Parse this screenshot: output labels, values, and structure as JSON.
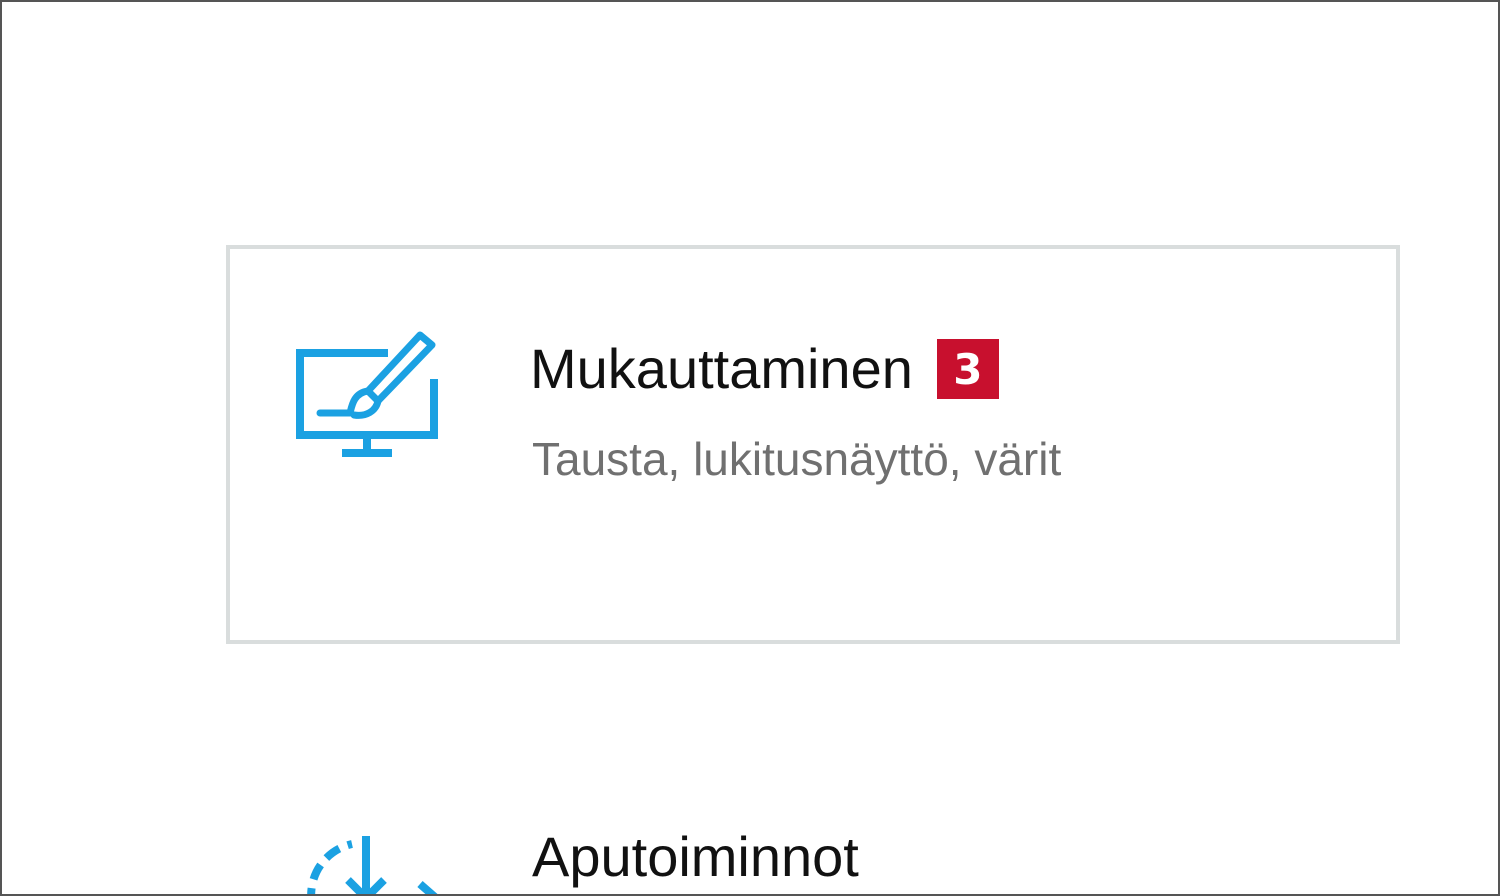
{
  "settings_items": [
    {
      "title": "Mukauttaminen",
      "subtitle": "Tausta, lukitusnäyttö, värit",
      "badge": "3",
      "icon": "personalization-icon"
    },
    {
      "title": "Aputoiminnot",
      "icon": "accessibility-icon"
    }
  ],
  "colors": {
    "accent": "#1ba1e2",
    "badge": "#c8102e",
    "tile_border": "#d9dddd"
  }
}
